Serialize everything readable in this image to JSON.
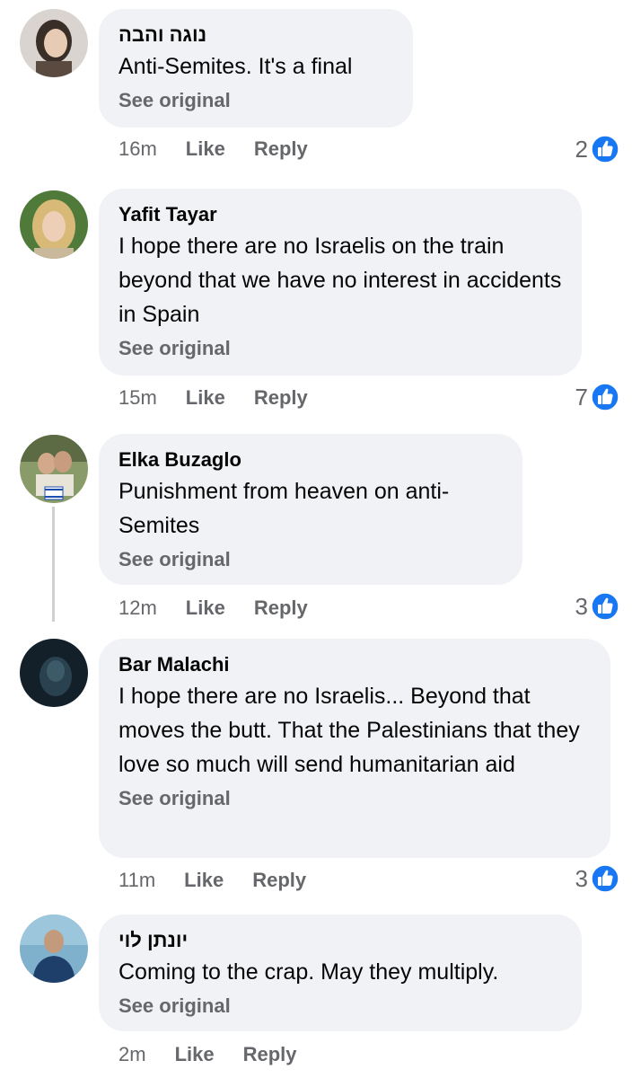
{
  "colors": {
    "bubble_bg": "#f0f2f5",
    "secondary_text": "#65676b",
    "like_blue": "#1877f2"
  },
  "comments": [
    {
      "author": "נוגה והבה",
      "text": "Anti-Semites. It's a final",
      "see_original": "See original",
      "time": "16m",
      "like": "Like",
      "reply": "Reply",
      "reaction_count": "2",
      "reaction_icon": "thumbs-up-icon"
    },
    {
      "author": "Yafit Tayar",
      "text": "I hope there are no Israelis on the train beyond that we have no interest in accidents in Spain",
      "see_original": "See original",
      "time": "15m",
      "like": "Like",
      "reply": "Reply",
      "reaction_count": "7",
      "reaction_icon": "thumbs-up-icon"
    },
    {
      "author": "Elka Buzaglo",
      "text": "Punishment from heaven on anti-Semites",
      "see_original": "See original",
      "time": "12m",
      "like": "Like",
      "reply": "Reply",
      "reaction_count": "3",
      "reaction_icon": "thumbs-up-icon"
    },
    {
      "author": "Bar Malachi",
      "text": "I hope there are no Israelis... Beyond that moves the butt. That the Palestinians that they love so much will send humanitarian aid",
      "see_original": "See original",
      "time": "11m",
      "like": "Like",
      "reply": "Reply",
      "reaction_count": "3",
      "reaction_icon": "thumbs-up-icon"
    },
    {
      "author": "יונתן לוי",
      "text": "Coming to the crap. May they multiply.",
      "see_original": "See original",
      "time": "2m",
      "like": "Like",
      "reply": "Reply"
    }
  ]
}
